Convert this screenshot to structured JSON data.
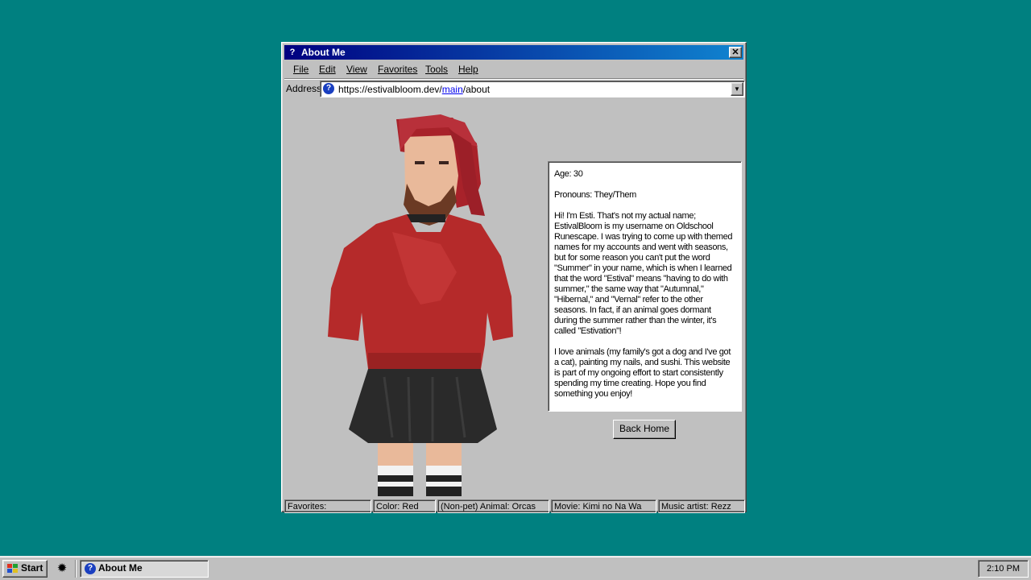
{
  "window": {
    "title": "About Me",
    "close_glyph": "✕",
    "title_icon": "help-question-icon"
  },
  "menu": [
    "File",
    "Edit",
    "View",
    "Favorites",
    "Tools",
    "Help"
  ],
  "address": {
    "label": "Address",
    "url_prefix": "https://estivalbloom.dev/",
    "url_link": "main",
    "url_suffix": "/about"
  },
  "bio": {
    "age": "Age: 30",
    "pronouns": "Pronouns: They/Them",
    "paragraph1": "Hi! I'm Esti. That's not my actual name; EstivalBloom is my username on Oldschool Runescape. I was trying to come up with themed names for my accounts and went with seasons, but for some reason you can't put the word \"Summer\" in your name, which is when I learned that the word \"Estival\" means \"having to do with summer,\" the same way that \"Autumnal,\" \"Hibernal,\" and \"Vernal\" refer to the other seasons. In fact, if an animal goes dormant during the summer rather than the winter, it's called \"Estivation\"!",
    "paragraph2": "I love animals (my family's got a dog and I've got a cat), painting my nails, and sushi. This website is part of my ongoing effort to start consistently spending my time creating. Hope you find something you enjoy!"
  },
  "back_button": "Back Home",
  "status": {
    "favorites": "Favorites:",
    "color": "Color: Red",
    "animal": "(Non-pet) Animal: Orcas",
    "movie": "Movie: Kimi no Na Wa",
    "music": "Music artist: Rezz"
  },
  "taskbar": {
    "start": "Start",
    "task": "About Me",
    "clock": "2:10 PM"
  },
  "colors": {
    "desktop": "#008080",
    "title_start": "#000080",
    "title_end": "#1084d0",
    "hoodie": "#b52a2a",
    "hair": "#a8222a",
    "skirt": "#2a2a2a"
  }
}
